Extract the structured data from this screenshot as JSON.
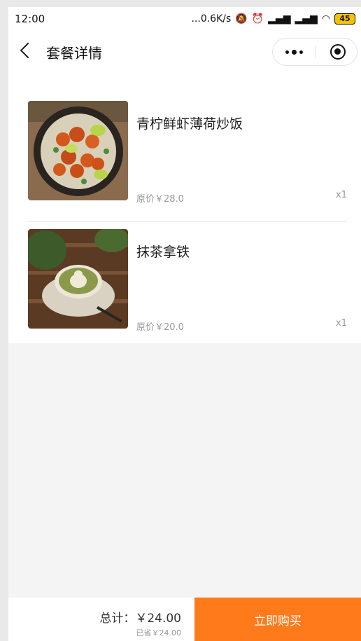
{
  "status_bar": {
    "time": "12:00",
    "network_speed": "...0.6K/s",
    "icons": [
      "mute-icon",
      "alarm-icon",
      "signal-icon",
      "hd-signal-icon",
      "wifi-icon"
    ],
    "battery": "45"
  },
  "nav": {
    "title": "套餐详情",
    "icons": [
      "back-icon",
      "more-icon",
      "target-icon"
    ]
  },
  "items": [
    {
      "name": "青柠鲜虾薄荷炒饭",
      "price": "原价￥28.0",
      "qty": "x1",
      "image": "shrimp-fried-rice-photo"
    },
    {
      "name": "抹茶拿铁",
      "price": "原价￥20.0",
      "qty": "x1",
      "image": "matcha-latte-photo"
    }
  ],
  "footer": {
    "total": "总计：￥24.00",
    "saved": "已省￥24.00",
    "buy_label": "立即购买"
  },
  "colors": {
    "accent": "#ff7a1a",
    "background": "#f4f4f4"
  }
}
